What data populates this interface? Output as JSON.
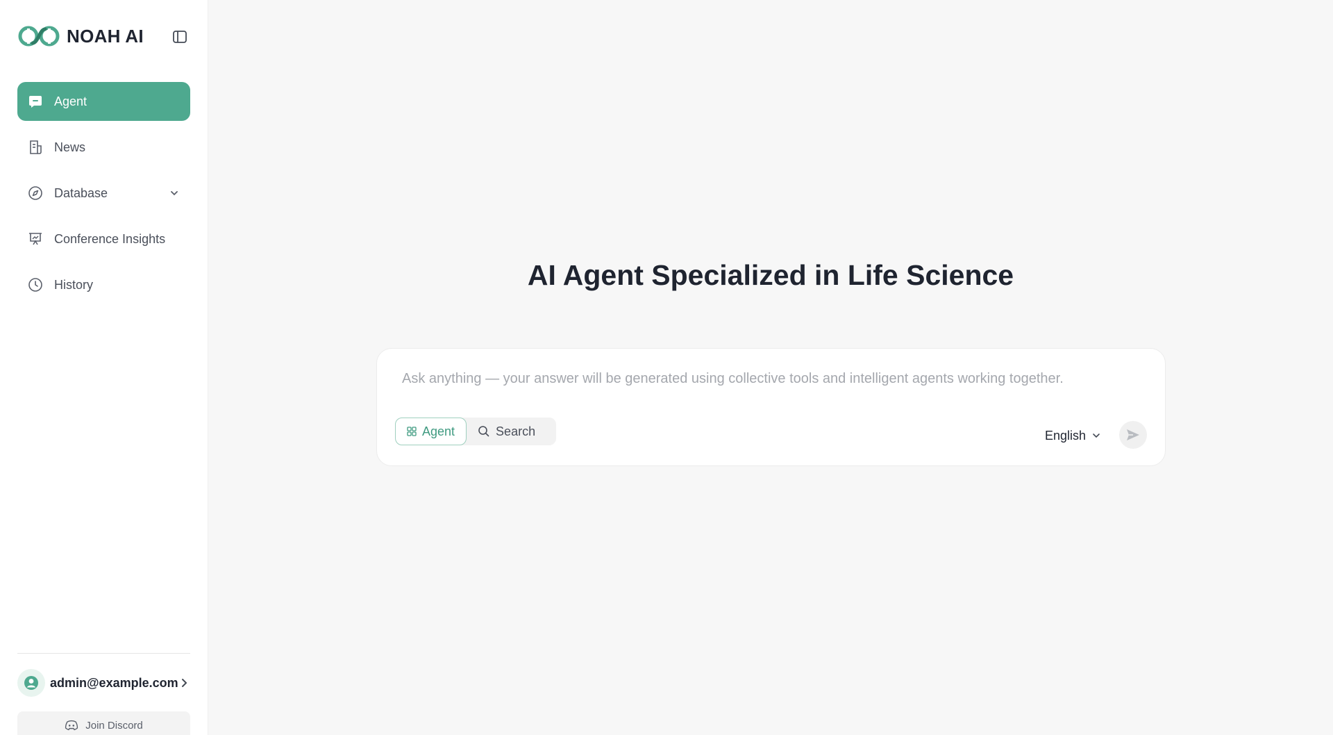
{
  "brand": {
    "name": "NOAH AI",
    "logo_icon": "noah-logo-icon"
  },
  "colors": {
    "accent": "#4ea98f",
    "accent_text": "#3f9a80",
    "background": "#f7f7f7",
    "text": "#1f2430"
  },
  "sidebar": {
    "collapse_icon": "sidebar-toggle-icon",
    "items": [
      {
        "label": "Agent",
        "icon": "chat-bubble-icon",
        "active": true
      },
      {
        "label": "News",
        "icon": "newspaper-icon"
      },
      {
        "label": "Database",
        "icon": "compass-icon",
        "expandable": true
      },
      {
        "label": "Conference Insights",
        "icon": "presentation-icon"
      },
      {
        "label": "History",
        "icon": "clock-icon"
      }
    ],
    "user": {
      "email": "admin@example.com",
      "icon": "user-avatar-icon"
    },
    "discord": {
      "label": "Join Discord",
      "icon": "discord-icon"
    }
  },
  "main": {
    "headline": "AI Agent Specialized in Life Science",
    "composer": {
      "placeholder": "Ask anything — your answer will be generated using collective tools and intelligent agents working together.",
      "value": "",
      "modes": [
        {
          "label": "Agent",
          "icon": "agent-grid-icon",
          "active": true
        },
        {
          "label": "Search",
          "icon": "search-icon"
        }
      ],
      "language": "English",
      "send_icon": "send-icon"
    }
  }
}
